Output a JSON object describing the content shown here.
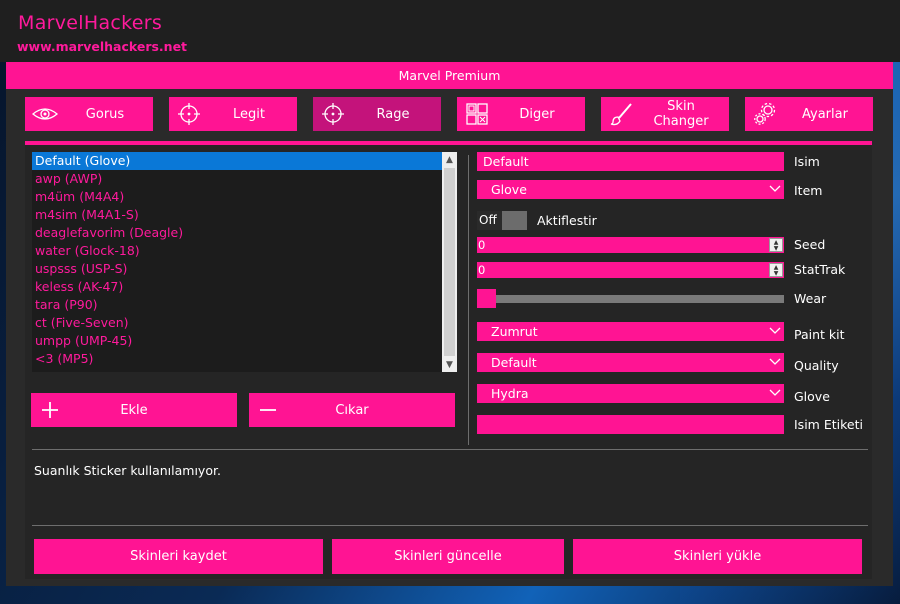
{
  "app": {
    "title": "MarvelHackers",
    "url": "www.marvelhackers.net"
  },
  "window": {
    "title": "Marvel Premium"
  },
  "tabs": [
    {
      "label": "Gorus",
      "icon": "eye-icon"
    },
    {
      "label": "Legit",
      "icon": "crosshair-icon"
    },
    {
      "label": "Rage",
      "icon": "crosshair-icon",
      "active": true
    },
    {
      "label": "Diger",
      "icon": "grid-icon"
    },
    {
      "label": "Skin Changer",
      "icon": "brush-icon"
    },
    {
      "label": "Ayarlar",
      "icon": "gears-icon"
    }
  ],
  "list": {
    "items": [
      "Default (Glove)",
      "awp (AWP)",
      "m4üm (M4A4)",
      "m4sim (M4A1-S)",
      "deaglefavorim (Deagle)",
      "water (Glock-18)",
      "uspsss (USP-S)",
      "keless (AK-47)",
      "tara (P90)",
      "ct (Five-Seven)",
      "umpp (UMP-45)",
      "<3 (MP5)"
    ],
    "selected_index": 0
  },
  "buttons": {
    "add": "Ekle",
    "remove": "Cıkar",
    "save": "Skinleri kaydet",
    "update": "Skinleri güncelle",
    "load": "Skinleri yükle"
  },
  "form": {
    "name": {
      "label": "Isim",
      "value": "Default"
    },
    "item": {
      "label": "Item",
      "value": "Glove"
    },
    "enable": {
      "label": "Aktiflestir",
      "state": "Off"
    },
    "seed": {
      "label": "Seed",
      "value": "0"
    },
    "stattrak": {
      "label": "StatTrak",
      "value": "0"
    },
    "wear": {
      "label": "Wear",
      "value": 0
    },
    "paint_kit": {
      "label": "Paint kit",
      "value": "Zumrut"
    },
    "quality": {
      "label": "Quality",
      "value": "Default"
    },
    "glove": {
      "label": "Glove",
      "value": "Hydra"
    },
    "name_tag": {
      "label": "Isim Etiketi",
      "value": ""
    }
  },
  "notice": "Suanlık Sticker kullanılamıyor.",
  "colors": {
    "accent": "#ff1493",
    "selection": "#0a78d7",
    "panel": "#252525"
  }
}
